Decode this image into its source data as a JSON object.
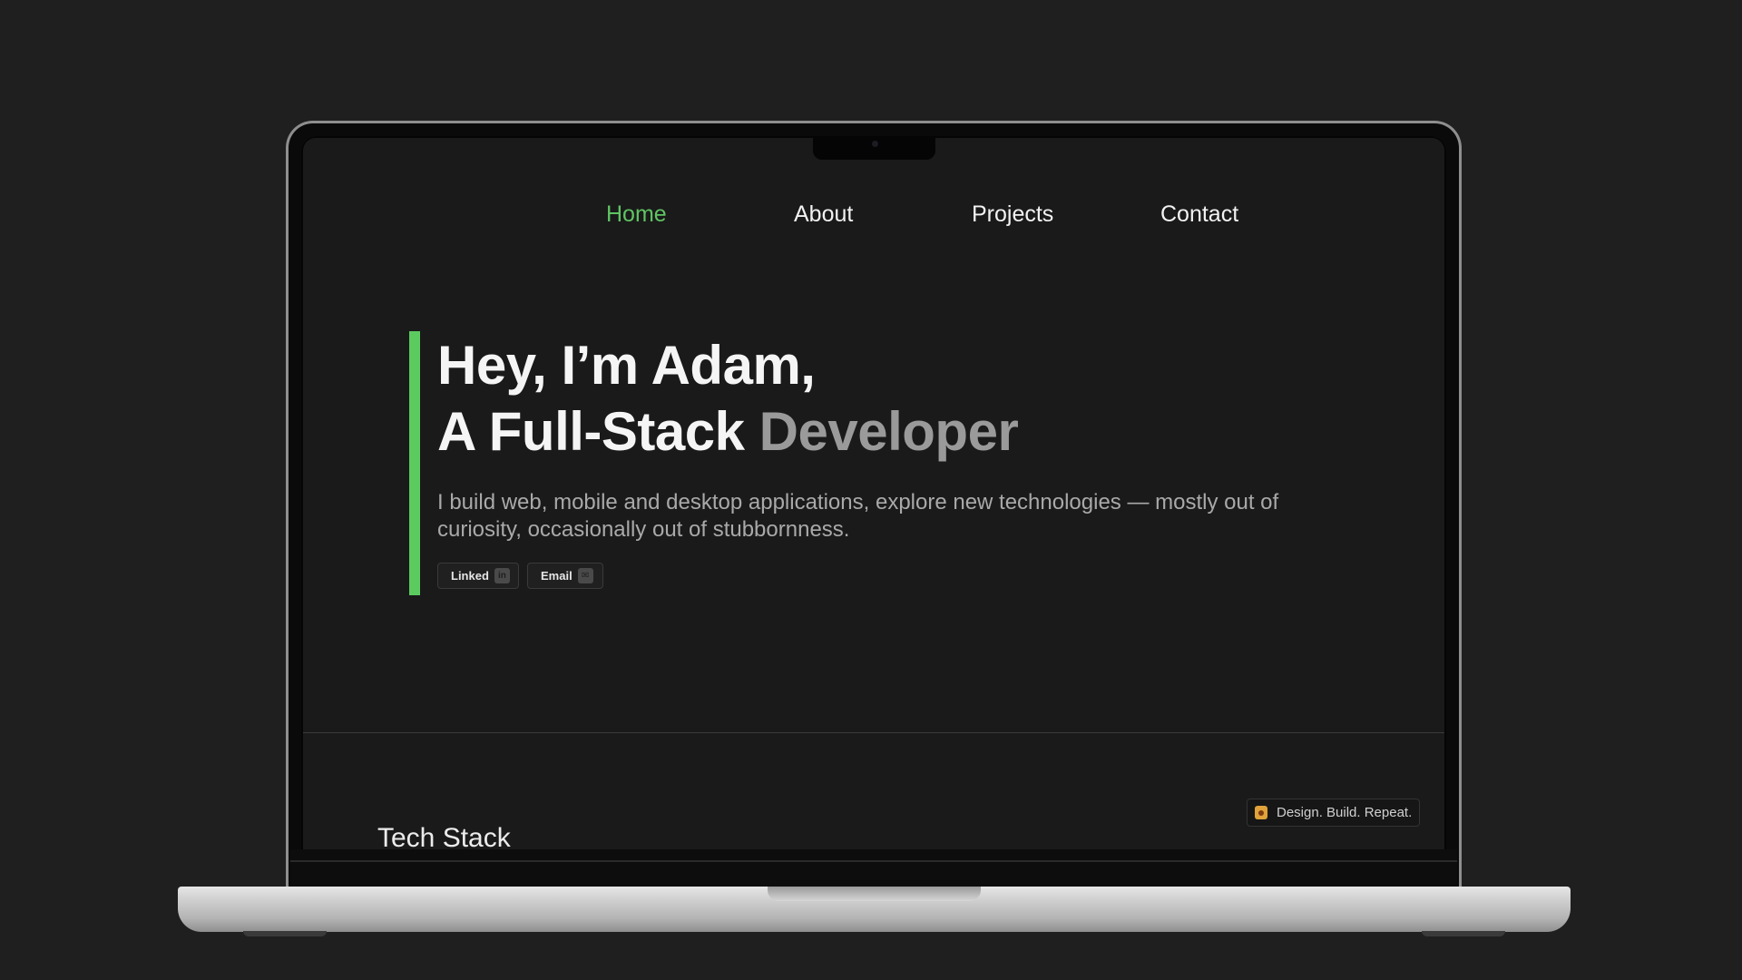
{
  "nav": {
    "items": [
      {
        "label": "Home",
        "active": true
      },
      {
        "label": "About",
        "active": false
      },
      {
        "label": "Projects",
        "active": false
      },
      {
        "label": "Contact",
        "active": false
      }
    ]
  },
  "hero": {
    "line1": "Hey, I’m Adam,",
    "line2_prefix": "A Full-Stack ",
    "line2_accent": "Developer",
    "description": "I build web, mobile and desktop applications, explore new technologies — mostly out of curiosity, occasionally out of stubbornness.",
    "links": [
      {
        "label": "Linked",
        "icon": "linkedin-icon",
        "icon_glyph": "in"
      },
      {
        "label": "Email",
        "icon": "email-icon",
        "icon_glyph": "✉"
      }
    ]
  },
  "badge": {
    "label": "Design. Build. Repeat.",
    "icon": "coffee-cup-icon"
  },
  "sections": {
    "tech_stack_title": "Tech Stack"
  },
  "colors": {
    "background": "#1a1a1a",
    "accent": "#5ccb5f",
    "text": "#f5f5f5",
    "muted": "#9a9a9a"
  }
}
